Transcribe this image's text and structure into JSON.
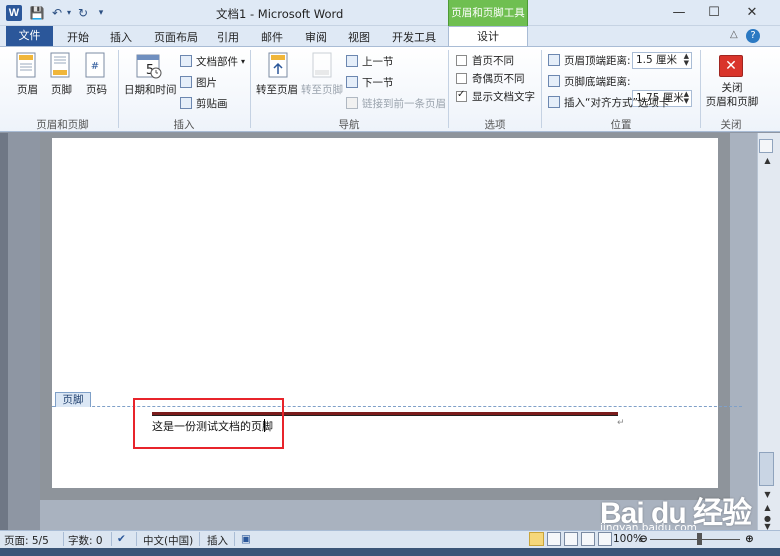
{
  "title_bar": {
    "title": "文档1 - Microsoft Word",
    "context_tools_label": "页眉和页脚工具",
    "controls": [
      "minimize-icon",
      "maximize-icon",
      "close-icon"
    ]
  },
  "ribbon_tabs": [
    "文件",
    "开始",
    "插入",
    "页面布局",
    "引用",
    "邮件",
    "审阅",
    "视图",
    "开发工具",
    "设计"
  ],
  "ribbon": {
    "groups": {
      "header_footer": {
        "label": "页眉和页脚",
        "buttons": [
          "页眉",
          "页脚",
          "页码"
        ]
      },
      "insert": {
        "label": "插入",
        "date_time": "日期和时间",
        "calendar_num": "5",
        "doc_parts": "文档部件",
        "picture": "图片",
        "clip_art": "剪贴画"
      },
      "navigation": {
        "label": "导航",
        "goto_header": "转至页眉",
        "goto_footer": "转至页脚",
        "prev_section": "上一节",
        "next_section": "下一节",
        "link_previous": "链接到前一条页眉"
      },
      "options": {
        "label": "选项",
        "first_page": {
          "text": "首页不同",
          "checked": false
        },
        "odd_even": {
          "text": "奇偶页不同",
          "checked": false
        },
        "show_doc_text": {
          "text": "显示文档文字",
          "checked": true
        }
      },
      "position": {
        "label": "位置",
        "header_distance_label": "页眉顶端距离:",
        "header_distance_value": "1.5 厘米",
        "footer_distance_label": "页脚底端距离:",
        "footer_distance_value": "1.75 厘米",
        "insert_align_tab": "插入“对齐方式”选项卡"
      },
      "close": {
        "label": "关闭",
        "button": "关闭\n页眉和页脚"
      }
    }
  },
  "document": {
    "footer_tag": "页脚",
    "footer_text": "这是一份测试文档的页脚",
    "paragraph_mark": "↵"
  },
  "status_bar": {
    "page": "页面: 5/5",
    "words": "字数: 0",
    "language": "中文(中国)",
    "mode": "插入",
    "zoom": "100%"
  },
  "watermark": {
    "logo": "Bai du 经验",
    "sub": "jingyan.baidu.com"
  },
  "colors": {
    "file_tab": "#2b579a",
    "context_tab": "#6fbf51",
    "highlight_box": "#e8242b",
    "footer_rule": "#7b1c1c"
  }
}
